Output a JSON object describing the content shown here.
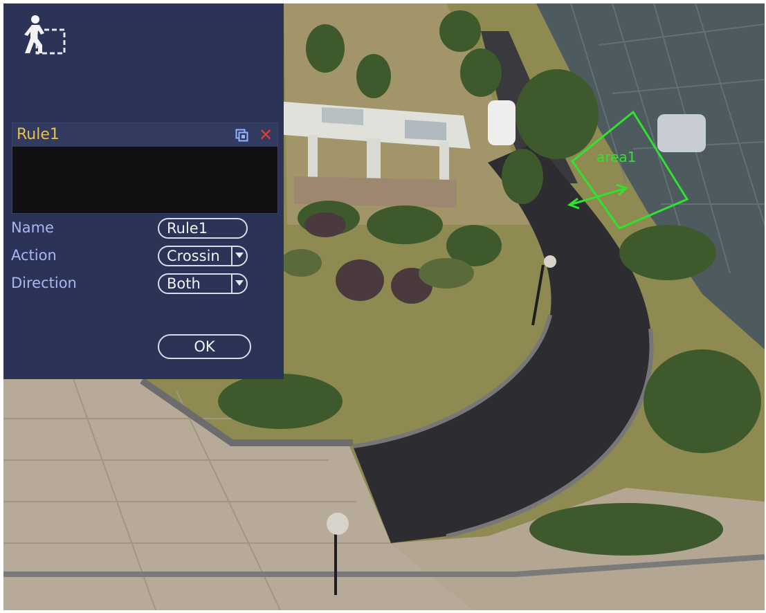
{
  "rule_list": {
    "selected_rule": "Rule1"
  },
  "form": {
    "name_label": "Name",
    "name_value": "Rule1",
    "action_label": "Action",
    "action_value": "Crossin",
    "direction_label": "Direction",
    "direction_value": "Both"
  },
  "buttons": {
    "ok_label": "OK"
  },
  "overlay": {
    "area_label": "area1",
    "area_color": "#2fe22f"
  },
  "icons": {
    "mode_icon": "walking-person-tripwire-icon",
    "edit_icon": "edit-region-icon",
    "delete_icon": "close-icon"
  },
  "colors": {
    "panel_bg": "#2b3357",
    "rule_highlight": "#e8c14a",
    "label_text": "#a9b6f4",
    "delete": "#e83a2a"
  }
}
